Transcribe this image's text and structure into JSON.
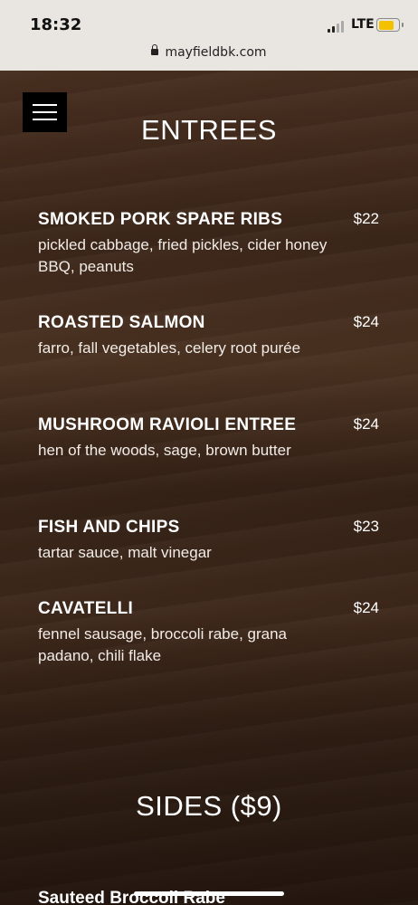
{
  "status_bar": {
    "time": "18:32",
    "network": "LTE",
    "battery_level": 0.8,
    "battery_color": "#f2c200"
  },
  "browser": {
    "url": "mayfieldbk.com"
  },
  "menu_button": {
    "icon": "hamburger-menu-icon"
  },
  "entrees": {
    "title": "ENTREES",
    "items": [
      {
        "name": "SMOKED PORK SPARE RIBS",
        "price": "$22",
        "description": "pickled cabbage, fried pickles, cider honey BBQ, peanuts"
      },
      {
        "name": "ROASTED SALMON",
        "price": "$24",
        "description": "farro, fall vegetables, celery root purée"
      },
      {
        "name": "MUSHROOM RAVIOLI ENTREE",
        "price": "$24",
        "description": "hen of the woods, sage, brown butter"
      },
      {
        "name": "FISH AND CHIPS",
        "price": "$23",
        "description": "tartar sauce, malt vinegar"
      },
      {
        "name": "CAVATELLI",
        "price": "$24",
        "description": "fennel sausage, broccoli rabe, grana padano, chili flake"
      }
    ]
  },
  "sides": {
    "title": "SIDES ($9)",
    "first_item": "Sauteed Broccoli Rabe"
  }
}
